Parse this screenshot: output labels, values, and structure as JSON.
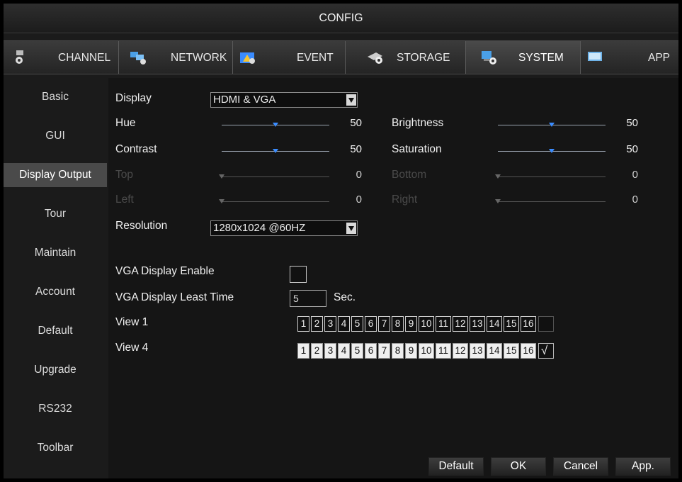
{
  "window": {
    "title": "CONFIG"
  },
  "tabs": [
    {
      "label": "CHANNEL",
      "icon": "camera-gear-icon"
    },
    {
      "label": "NETWORK",
      "icon": "network-gear-icon"
    },
    {
      "label": "EVENT",
      "icon": "event-icon"
    },
    {
      "label": "STORAGE",
      "icon": "storage-gear-icon"
    },
    {
      "label": "SYSTEM",
      "icon": "system-gear-icon",
      "active": true
    },
    {
      "label": "APP",
      "icon": "app-icon"
    }
  ],
  "menu": [
    {
      "label": "Basic"
    },
    {
      "label": "GUI"
    },
    {
      "label": "Display Output",
      "active": true
    },
    {
      "label": "Tour"
    },
    {
      "label": "Maintain"
    },
    {
      "label": "Account"
    },
    {
      "label": "Default"
    },
    {
      "label": "Upgrade"
    },
    {
      "label": "RS232"
    },
    {
      "label": "Toolbar"
    }
  ],
  "display": {
    "label": "Display",
    "value": "HDMI & VGA"
  },
  "sliders": {
    "hue": {
      "label": "Hue",
      "value": "50",
      "level": 0.5
    },
    "brightness": {
      "label": "Brightness",
      "value": "50",
      "level": 0.5
    },
    "contrast": {
      "label": "Contrast",
      "value": "50",
      "level": 0.5
    },
    "saturation": {
      "label": "Saturation",
      "value": "50",
      "level": 0.5
    },
    "top": {
      "label": "Top",
      "value": "0",
      "level": 0
    },
    "bottom": {
      "label": "Bottom",
      "value": "0",
      "level": 0
    },
    "left": {
      "label": "Left",
      "value": "0",
      "level": 0
    },
    "right": {
      "label": "Right",
      "value": "0",
      "level": 0
    }
  },
  "resolution": {
    "label": "Resolution",
    "value": "1280x1024 @60HZ"
  },
  "vga_enable": {
    "label": "VGA Display Enable",
    "checked": false
  },
  "vga_least_time": {
    "label": "VGA Display Least Time",
    "value": "5",
    "unit": "Sec."
  },
  "views": [
    {
      "label": "View 1",
      "cells": [
        "1",
        "2",
        "3",
        "4",
        "5",
        "6",
        "7",
        "8",
        "9",
        "10",
        "11",
        "12",
        "13",
        "14",
        "15",
        "16"
      ],
      "all_checked": false
    },
    {
      "label": "View 4",
      "cells": [
        "1",
        "2",
        "3",
        "4",
        "5",
        "6",
        "7",
        "8",
        "9",
        "10",
        "11",
        "12",
        "13",
        "14",
        "15",
        "16"
      ],
      "all_checked": true
    }
  ],
  "buttons": {
    "default": "Default",
    "ok": "OK",
    "cancel": "Cancel",
    "apply": "App."
  },
  "colors": {
    "accent": "#3a8cff",
    "background": "#151515",
    "active_menu": "#4a4a4a"
  }
}
